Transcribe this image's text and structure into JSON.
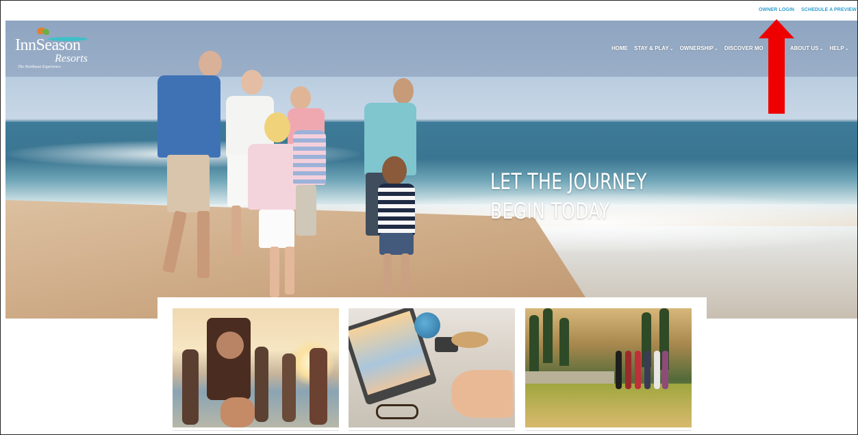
{
  "utility_bar": {
    "owner_login": "OWNER LOGIN",
    "schedule_preview": "SCHEDULE A PREVIEW",
    "link_color": "#2f9fcf"
  },
  "logo": {
    "name": "InnSeason",
    "sub": "Resorts",
    "tagline": "The Northeast Experience"
  },
  "nav": {
    "items": [
      {
        "label": "HOME",
        "dropdown": false
      },
      {
        "label": "STAY & PLAY",
        "dropdown": true
      },
      {
        "label": "OWNERSHIP",
        "dropdown": true
      },
      {
        "label": "DISCOVER MO",
        "dropdown": false
      },
      {
        "label": "ABOUT US",
        "dropdown": true
      },
      {
        "label": "HELP",
        "dropdown": true
      }
    ],
    "chevron": "⌄"
  },
  "hero": {
    "headline_line1": "LET THE JOURNEY",
    "headline_line2": "BEGIN TODAY"
  },
  "annotation": {
    "arrow_color": "#ee0000",
    "icon": "arrow-up-icon"
  },
  "cards": [
    {
      "image": "beach-party-friends"
    },
    {
      "image": "travel-planning-laptop"
    },
    {
      "image": "hiking-friends-meadow"
    }
  ]
}
